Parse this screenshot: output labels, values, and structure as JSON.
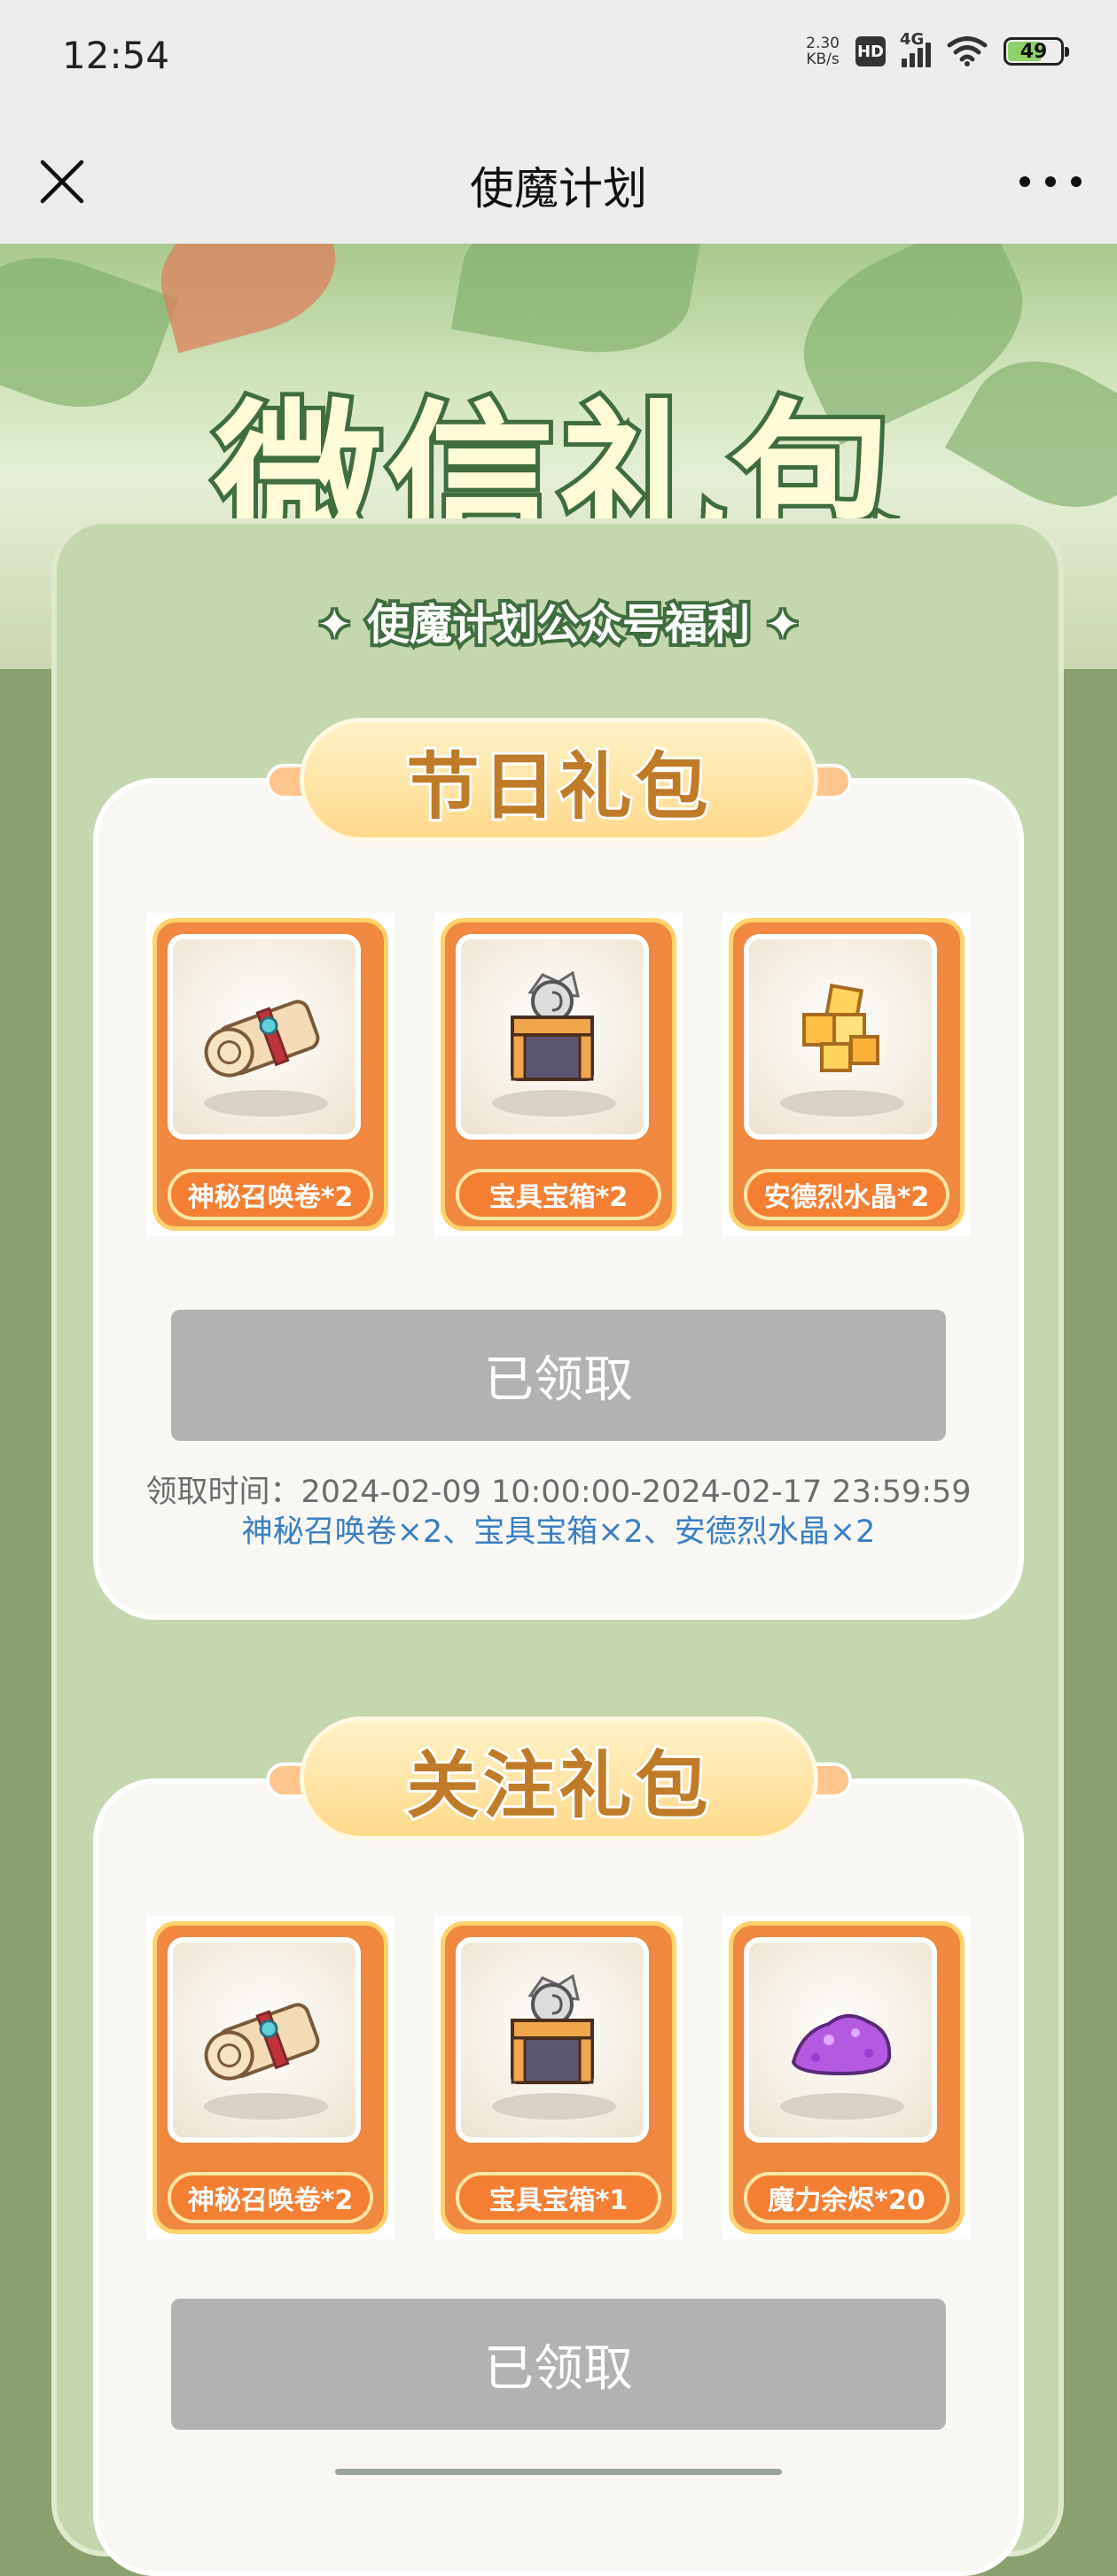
{
  "status_bar": {
    "time": "12:54",
    "speed_value": "2.30",
    "speed_unit": "KB/s",
    "hd": "HD",
    "network": "4G",
    "battery": "49"
  },
  "nav": {
    "title": "使魔计划"
  },
  "banner": {
    "title": "微信礼包",
    "subtitle": "✦ 使魔计划公众号福利 ✦"
  },
  "festival_pack": {
    "title": "节日礼包",
    "items": [
      {
        "label": "神秘召唤卷*2",
        "icon": "scroll-icon"
      },
      {
        "label": "宝具宝箱*2",
        "icon": "chest-icon"
      },
      {
        "label": "安德烈水晶*2",
        "icon": "crystal-icon"
      }
    ],
    "button": "已领取",
    "claim_time": "领取时间：2024-02-09 10:00:00-2024-02-17 23:59:59",
    "rewards": "神秘召唤卷×2、宝具宝箱×2、安德烈水晶×2"
  },
  "follow_pack": {
    "title": "关注礼包",
    "items": [
      {
        "label": "神秘召唤卷*2",
        "icon": "scroll-icon"
      },
      {
        "label": "宝具宝箱*1",
        "icon": "chest-icon"
      },
      {
        "label": "魔力余烬*20",
        "icon": "ember-icon"
      }
    ],
    "button": "已领取"
  },
  "colors": {
    "page_bg": "#8aa06f",
    "item_orange": "#f0883f",
    "item_border": "#ffd36a",
    "ribbon_text": "#c07b29",
    "button_claimed": "#b2b2b2",
    "reward_link": "#3a7fc2"
  }
}
